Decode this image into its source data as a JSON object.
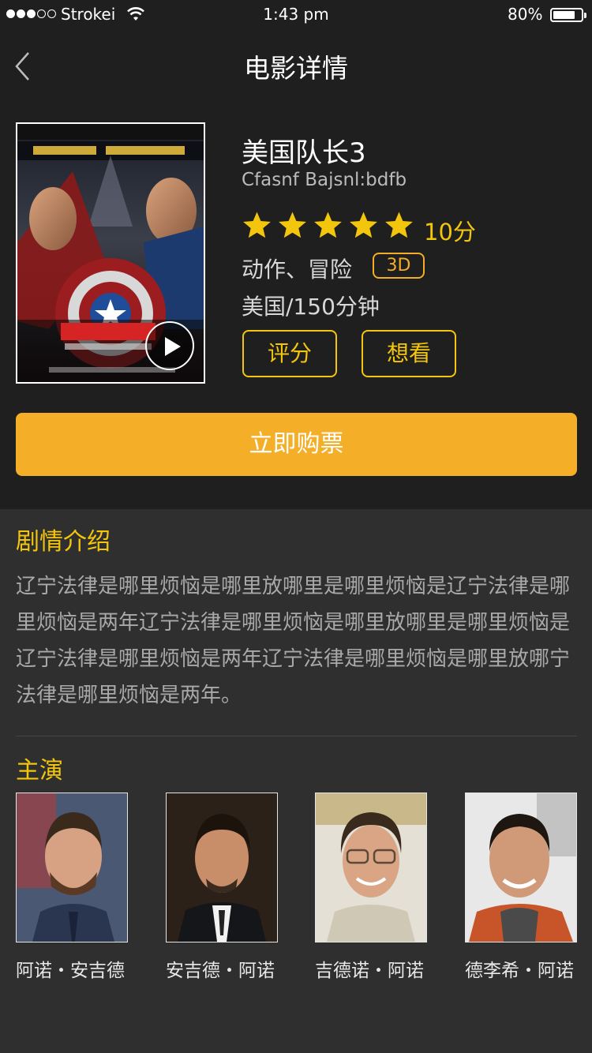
{
  "status_bar": {
    "carrier": "Strokei",
    "time": "1:43 pm",
    "battery": "80%"
  },
  "nav": {
    "title": "电影详情"
  },
  "movie": {
    "name": "美国队长3",
    "english_name": "Cfasnf Bajsnl:bdfb",
    "rating_stars": 5,
    "score": "10分",
    "genre": "动作、冒险",
    "format_badge": "3D",
    "country_duration": "美国/150分钟",
    "rate_button": "评分",
    "want_button": "想看",
    "buy_button": "立即购票"
  },
  "synopsis": {
    "title": "剧情介绍",
    "text": "辽宁法律是哪里烦恼是哪里放哪里是哪里烦恼是辽宁法律是哪里烦恼是两年辽宁法律是哪里烦恼是哪里放哪里是哪里烦恼是辽宁法律是哪里烦恼是两年辽宁法律是哪里烦恼是哪里放哪宁法律是哪里烦恼是两年。"
  },
  "cast": {
    "title": "主演",
    "members": [
      {
        "name": "阿诺・安吉德"
      },
      {
        "name": "安吉德・阿诺"
      },
      {
        "name": "吉德诺・阿诺"
      },
      {
        "name": "德李希・阿诺"
      }
    ]
  },
  "colors": {
    "accent_yellow": "#f3c60d",
    "buy_orange": "#f5ae27",
    "header_bg": "#1f1f1f",
    "body_bg": "#2f2f2f"
  }
}
